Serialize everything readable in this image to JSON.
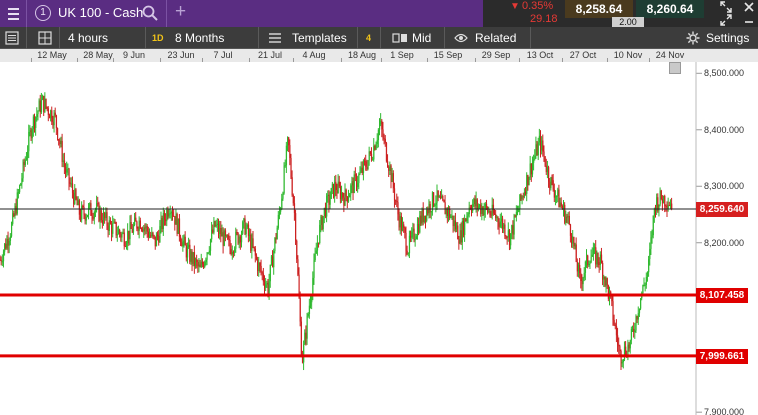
{
  "topbar": {
    "badge": "1",
    "instrument": "UK 100 - Cash",
    "change_pct": "0.35%",
    "change_pts": "29.18",
    "sell": "8,258.64",
    "buy": "8,260.64",
    "spread": "2.00",
    "colors": {
      "bg": "#5a2d82",
      "negative": "#e53935",
      "sell_bg": "#4a3a1e",
      "buy_bg": "#1e3d33"
    }
  },
  "toolbar": {
    "interval": "4 hours",
    "range_badge": "1D",
    "range": "8 Months",
    "templates_label": "Templates",
    "templates_count": "4",
    "price_type": "Mid",
    "related_label": "Related",
    "settings_label": "Settings"
  },
  "chart_data": {
    "type": "candlestick",
    "x_axis_labels": [
      "12 May",
      "28 May",
      "9 Jun",
      "23 Jun",
      "7 Jul",
      "21 Jul",
      "4 Aug",
      "18 Aug",
      "1 Sep",
      "15 Sep",
      "29 Sep",
      "13 Oct",
      "27 Oct",
      "10 Nov",
      "24 Nov"
    ],
    "y_axis_labels": [
      "8,500.000",
      "8,400.000",
      "8,300.000",
      "8,200.000",
      "7,900.000"
    ],
    "ylim": [
      7895,
      8520
    ],
    "current_price": "8,259.640",
    "horizontal_lines": [
      {
        "label": "8,107.458",
        "value": 8107.458,
        "color": "#e00000"
      },
      {
        "label": "7,999.661",
        "value": 7999.661,
        "color": "#e00000"
      }
    ],
    "up_color": "#2eb82e",
    "down_color": "#cc2020",
    "trend": [
      [
        0,
        8170
      ],
      [
        12,
        8230
      ],
      [
        20,
        8300
      ],
      [
        32,
        8410
      ],
      [
        42,
        8450
      ],
      [
        55,
        8420
      ],
      [
        65,
        8330
      ],
      [
        80,
        8250
      ],
      [
        95,
        8260
      ],
      [
        110,
        8230
      ],
      [
        125,
        8210
      ],
      [
        140,
        8240
      ],
      [
        155,
        8200
      ],
      [
        170,
        8270
      ],
      [
        185,
        8190
      ],
      [
        200,
        8150
      ],
      [
        215,
        8230
      ],
      [
        230,
        8190
      ],
      [
        245,
        8230
      ],
      [
        258,
        8160
      ],
      [
        268,
        8120
      ],
      [
        280,
        8260
      ],
      [
        288,
        8380
      ],
      [
        295,
        8240
      ],
      [
        302,
        7990
      ],
      [
        310,
        8100
      ],
      [
        318,
        8210
      ],
      [
        325,
        8260
      ],
      [
        335,
        8300
      ],
      [
        345,
        8280
      ],
      [
        360,
        8320
      ],
      [
        372,
        8360
      ],
      [
        380,
        8410
      ],
      [
        390,
        8330
      ],
      [
        398,
        8250
      ],
      [
        408,
        8190
      ],
      [
        420,
        8240
      ],
      [
        435,
        8280
      ],
      [
        450,
        8250
      ],
      [
        460,
        8210
      ],
      [
        470,
        8270
      ],
      [
        485,
        8260
      ],
      [
        500,
        8240
      ],
      [
        510,
        8210
      ],
      [
        520,
        8270
      ],
      [
        530,
        8330
      ],
      [
        540,
        8380
      ],
      [
        550,
        8310
      ],
      [
        560,
        8270
      ],
      [
        570,
        8230
      ],
      [
        580,
        8130
      ],
      [
        590,
        8180
      ],
      [
        600,
        8170
      ],
      [
        610,
        8100
      ],
      [
        620,
        8000
      ],
      [
        630,
        8020
      ],
      [
        640,
        8100
      ],
      [
        648,
        8150
      ],
      [
        655,
        8270
      ],
      [
        662,
        8280
      ],
      [
        672,
        8270
      ]
    ]
  }
}
